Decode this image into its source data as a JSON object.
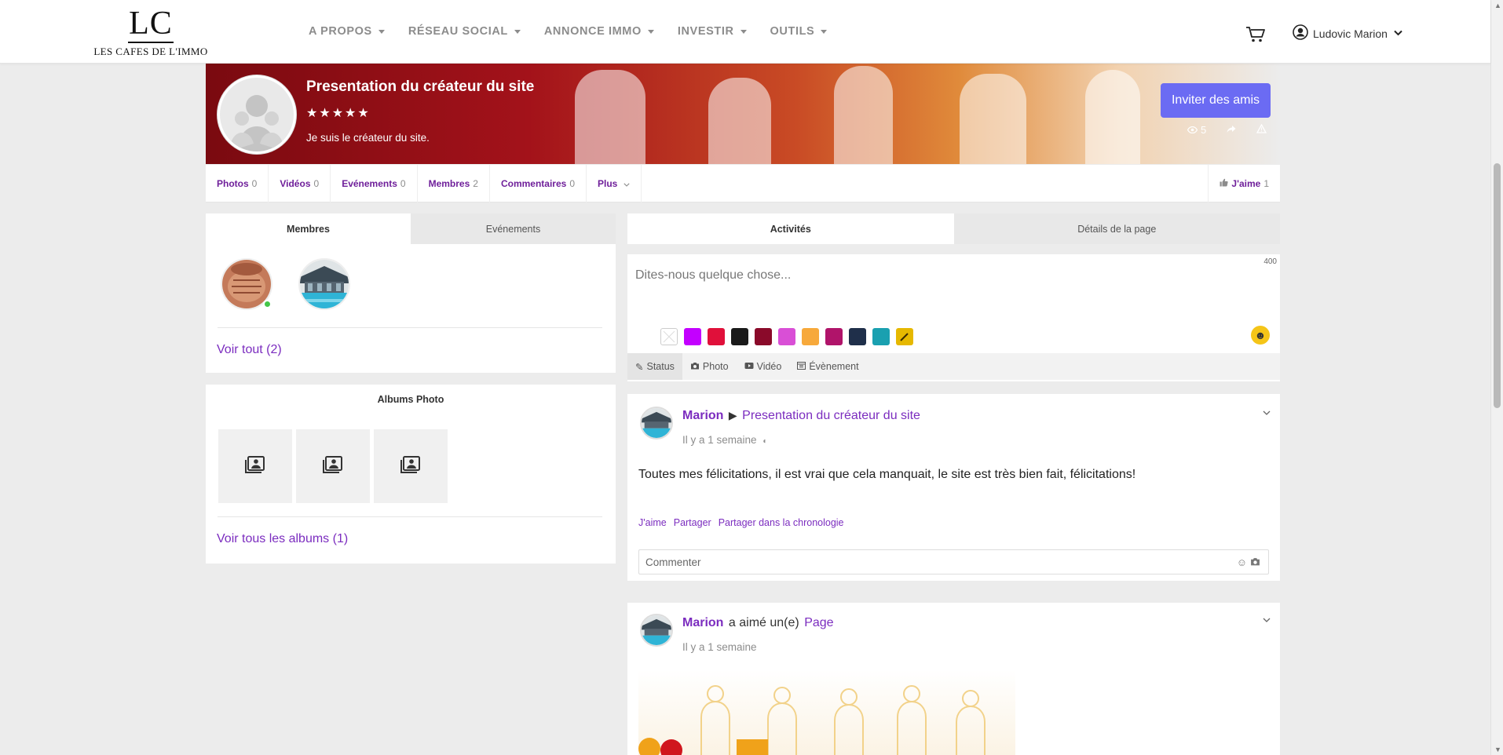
{
  "nav": {
    "logo_mark": "LC",
    "logo_name": "LES CAFES DE L'IMMO",
    "menu": [
      "A PROPOS",
      "RÉSEAU SOCIAL",
      "ANNONCE IMMO",
      "INVESTIR",
      "OUTILS"
    ],
    "user_name": "Ludovic Marion"
  },
  "cover": {
    "title": "Presentation du créateur du site",
    "stars": "★★★★★",
    "description": "Je suis le créateur du site.",
    "invite_label": "Inviter des amis",
    "views_count": "5"
  },
  "tabs": [
    {
      "label": "Photos",
      "count": "0"
    },
    {
      "label": "Vidéos",
      "count": "0"
    },
    {
      "label": "Evénements",
      "count": "0"
    },
    {
      "label": "Membres",
      "count": "2"
    },
    {
      "label": "Commentaires",
      "count": "0"
    },
    {
      "label": "Plus",
      "count": ""
    }
  ],
  "like_tab": {
    "label": "J'aime",
    "count": "1"
  },
  "left": {
    "seg_members": "Membres",
    "seg_events": "Evénements",
    "see_all": "Voir tout (2)",
    "albums_title": "Albums Photo",
    "see_all_albums": "Voir tous les albums (1)"
  },
  "right": {
    "seg_activities": "Activités",
    "seg_details": "Détails de la page",
    "composer_placeholder": "Dites-nous quelque chose...",
    "char_count": "400",
    "swatch_colors": [
      "#ffffff",
      "#c300ff",
      "#e0103a",
      "#1a1a1a",
      "#8a0a2a",
      "#d94fd6",
      "#f7a93b",
      "#b0146a",
      "#1f2f4a",
      "#1aa0b0",
      "#e6b800"
    ],
    "composer_tabs": [
      "Status",
      "Photo",
      "Vidéo",
      "Évènement"
    ]
  },
  "posts": [
    {
      "author": "Marion",
      "arrow": "▶",
      "target": "Presentation du créateur du site",
      "time": "Il y a 1 semaine",
      "text": "Toutes mes félicitations, il est vrai que cela manquait, le site est très bien fait, félicitations!",
      "actions": [
        "J'aime",
        "Partager",
        "Partager dans la chronologie"
      ],
      "comment_placeholder": "Commenter"
    },
    {
      "author": "Marion",
      "verb": "a aimé un(e)",
      "target": "Page",
      "time": "Il y a 1 semaine"
    }
  ]
}
